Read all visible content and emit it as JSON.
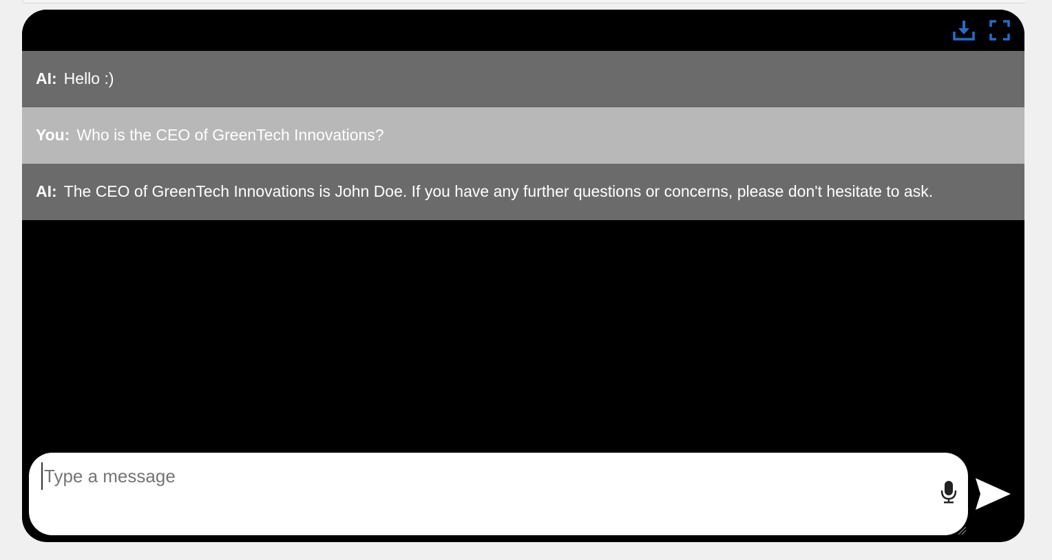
{
  "header": {
    "download_icon": "download-icon",
    "fullscreen_icon": "fullscreen-icon",
    "accent_color": "#1f6fd1"
  },
  "messages": [
    {
      "role": "ai",
      "speaker": "AI:",
      "text": "Hello :)"
    },
    {
      "role": "user",
      "speaker": "You:",
      "text": "Who is the CEO of GreenTech Innovations?"
    },
    {
      "role": "ai",
      "speaker": "AI:",
      "text": "The CEO of GreenTech Innovations is John Doe. If you have any further questions or concerns, please don't hesitate to ask."
    }
  ],
  "composer": {
    "placeholder": "Type a message",
    "value": "",
    "mic_icon": "microphone-icon",
    "send_icon": "send-icon"
  },
  "colors": {
    "widget_background": "#000000",
    "ai_message_background": "#6b6b6b",
    "user_message_background": "#b8b8b8",
    "message_text": "#ffffff"
  }
}
